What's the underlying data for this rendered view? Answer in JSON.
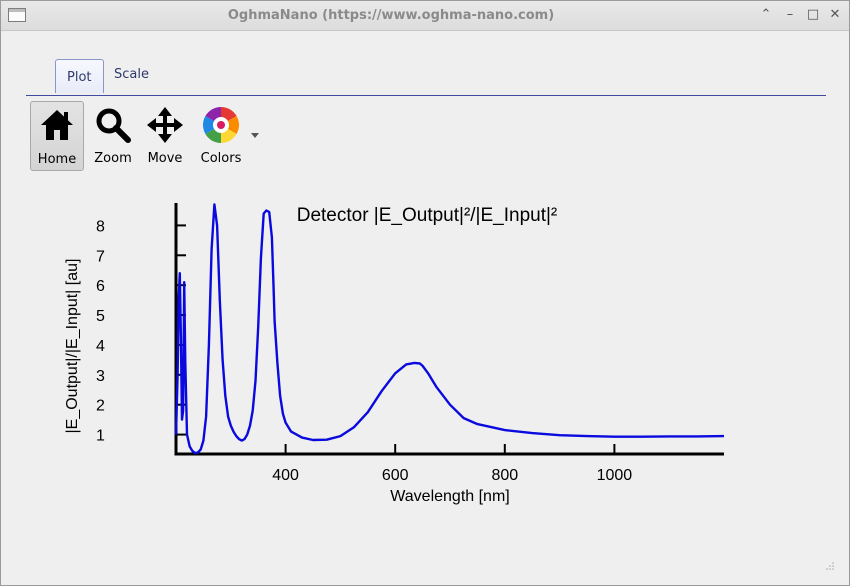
{
  "window": {
    "title": "OghmaNano (https://www.oghma-nano.com)"
  },
  "tabs": [
    {
      "label": "Plot",
      "active": true
    },
    {
      "label": "Scale",
      "active": false
    }
  ],
  "toolbar": {
    "home": "Home",
    "zoom": "Zoom",
    "move": "Move",
    "colors": "Colors"
  },
  "chart_data": {
    "type": "line",
    "title": "Detector |E_Output|²/|E_Input|²",
    "xlabel": "Wavelength [nm]",
    "ylabel": "|E_Output|/|E_Input| [au]",
    "xlim": [
      200,
      1200
    ],
    "ylim": [
      0.35,
      8.75
    ],
    "xticks": [
      400,
      600,
      800,
      1000
    ],
    "yticks": [
      1,
      2,
      3,
      4,
      5,
      6,
      7,
      8
    ],
    "series": [
      {
        "color": "#0a0adf",
        "x": [
          200,
          203,
          205,
          207,
          209,
          211,
          213,
          215,
          217,
          220,
          225,
          230,
          235,
          240,
          245,
          250,
          255,
          260,
          265,
          270,
          275,
          280,
          285,
          290,
          295,
          300,
          305,
          310,
          315,
          320,
          325,
          330,
          335,
          340,
          345,
          350,
          355,
          360,
          365,
          370,
          375,
          378,
          380,
          385,
          390,
          395,
          400,
          410,
          420,
          430,
          450,
          475,
          500,
          525,
          550,
          575,
          600,
          620,
          635,
          645,
          650,
          660,
          675,
          700,
          725,
          750,
          800,
          850,
          900,
          950,
          1000,
          1050,
          1100,
          1150,
          1200
        ],
        "y": [
          1.0,
          3.0,
          5.6,
          6.4,
          4.2,
          1.5,
          1.8,
          6.1,
          3.4,
          1.0,
          0.6,
          0.45,
          0.38,
          0.4,
          0.5,
          0.8,
          1.6,
          4.0,
          7.2,
          8.7,
          8.0,
          5.5,
          3.5,
          2.3,
          1.6,
          1.3,
          1.1,
          0.95,
          0.85,
          0.8,
          0.85,
          1.0,
          1.3,
          1.8,
          2.8,
          4.6,
          6.9,
          8.4,
          8.5,
          8.45,
          7.6,
          6.0,
          4.8,
          3.4,
          2.3,
          1.7,
          1.4,
          1.1,
          1.0,
          0.9,
          0.82,
          0.83,
          0.95,
          1.25,
          1.75,
          2.45,
          3.05,
          3.35,
          3.4,
          3.38,
          3.3,
          3.05,
          2.6,
          2.0,
          1.55,
          1.35,
          1.15,
          1.05,
          0.98,
          0.95,
          0.93,
          0.93,
          0.94,
          0.94,
          0.95
        ]
      }
    ]
  }
}
